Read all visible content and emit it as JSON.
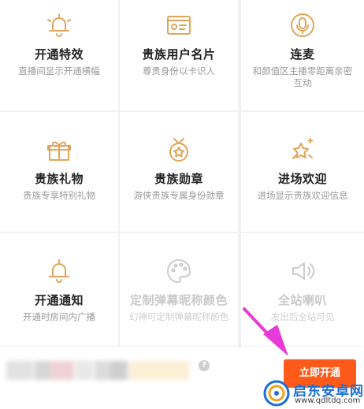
{
  "privileges": [
    {
      "title": "开通特效",
      "desc": "直播间显示开通横幅",
      "icon": "bell-icon",
      "enabled": true
    },
    {
      "title": "贵族用户名片",
      "desc": "尊贵身份以卡识人",
      "icon": "id-card-icon",
      "enabled": true
    },
    {
      "title": "连麦",
      "desc": "和颜值区主播零距离亲密互动",
      "icon": "microphone-icon",
      "enabled": true
    },
    {
      "title": "贵族礼物",
      "desc": "贵族专享特别礼物",
      "icon": "gift-icon",
      "enabled": true
    },
    {
      "title": "贵族勋章",
      "desc": "游侠贵族专属身份勋章",
      "icon": "medal-icon",
      "enabled": true
    },
    {
      "title": "进场欢迎",
      "desc": "进场显示贵族欢迎信息",
      "icon": "sparkle-star-icon",
      "enabled": true
    },
    {
      "title": "开通通知",
      "desc": "开通时房间内广播",
      "icon": "bell-icon",
      "enabled": true
    },
    {
      "title": "定制弹幕昵称颜色",
      "desc": "幻神可定制弹幕昵称颜色",
      "icon": "palette-icon",
      "enabled": false
    },
    {
      "title": "全站喇叭",
      "desc": "发出后全站可见",
      "icon": "speaker-icon",
      "enabled": false
    }
  ],
  "bottom_bar": {
    "help_label": "?",
    "open_button_label": "立即开通"
  },
  "colors": {
    "accent_gold": "#e0a55a",
    "button_orange": "#ff5a1a",
    "annotation_arrow": "#e83ad8"
  },
  "watermark": {
    "name": "启东安卓网",
    "url": "www.qdltdq.com"
  }
}
